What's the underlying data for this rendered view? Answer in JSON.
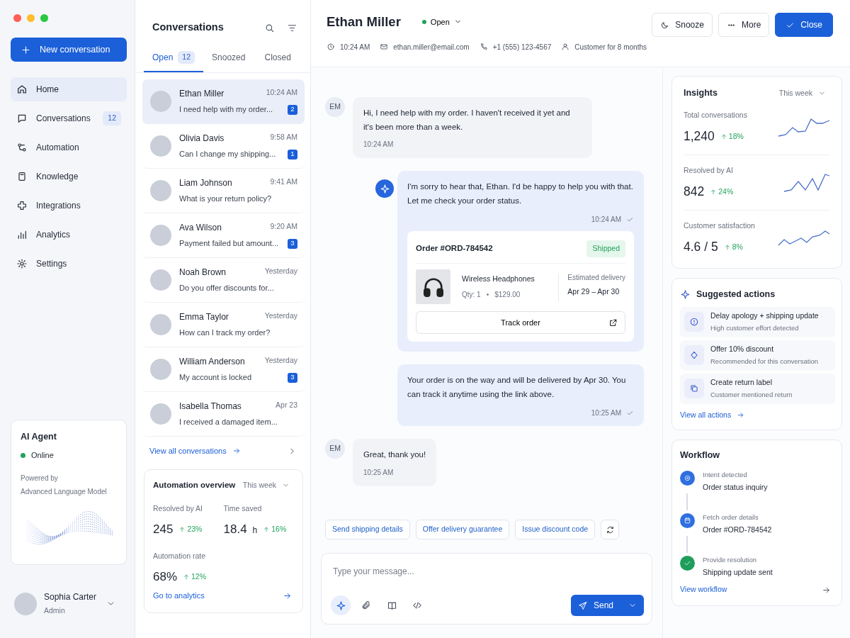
{
  "sidebar": {
    "new_button": "New conversation",
    "nav": [
      {
        "label": "Home",
        "selected": true
      },
      {
        "label": "Conversations",
        "selected": false,
        "count": "12"
      },
      {
        "label": "Automation",
        "selected": false
      },
      {
        "label": "Knowledge",
        "selected": false
      },
      {
        "label": "Integrations",
        "selected": false
      },
      {
        "label": "Analytics",
        "selected": false
      },
      {
        "label": "Settings",
        "selected": false
      }
    ],
    "ai_agent": {
      "title": "AI Agent",
      "status": "Online",
      "powered_by": "Powered by",
      "model": "Advanced Language Model"
    },
    "user": {
      "name": "Sophia Carter",
      "role": "Admin"
    }
  },
  "conversation_list": {
    "title": "Conversations",
    "tabs": [
      {
        "label": "Open",
        "count": "12",
        "selected": true
      },
      {
        "label": "Snoozed",
        "selected": false
      },
      {
        "label": "Closed",
        "selected": false
      }
    ],
    "items": [
      {
        "name": "Ethan Miller",
        "time": "10:24 AM",
        "preview": "I need help with my order...",
        "unread": "2",
        "selected": true
      },
      {
        "name": "Olivia Davis",
        "time": "9:58 AM",
        "preview": "Can I change my shipping...",
        "unread": "1",
        "selected": false
      },
      {
        "name": "Liam Johnson",
        "time": "9:41 AM",
        "preview": "What is your return policy?",
        "selected": false
      },
      {
        "name": "Ava Wilson",
        "time": "9:20 AM",
        "preview": "Payment failed but amount...",
        "unread": "3",
        "selected": false
      },
      {
        "name": "Noah Brown",
        "time": "Yesterday",
        "preview": "Do you offer discounts for...",
        "selected": false
      },
      {
        "name": "Emma Taylor",
        "time": "Yesterday",
        "preview": "How can I track my order?",
        "selected": false
      },
      {
        "name": "William Anderson",
        "time": "Yesterday",
        "preview": "My account is locked",
        "unread": "3",
        "selected": false
      },
      {
        "name": "Isabella Thomas",
        "time": "Apr 23",
        "preview": "I received a damaged item...",
        "selected": false
      }
    ],
    "view_all": "View all conversations"
  },
  "automation_overview": {
    "title": "Automation overview",
    "period": "This week",
    "stats": [
      {
        "label": "Resolved by AI",
        "value": "245",
        "change": "23%"
      },
      {
        "label": "Time saved",
        "value": "18.4",
        "unit": "h",
        "change": "16%"
      },
      {
        "label": "Automation rate",
        "value": "68%",
        "change": "12%"
      }
    ],
    "link": "Go to analytics"
  },
  "conversation": {
    "customer_name": "Ethan Miller",
    "status": "Open",
    "meta": [
      "10:24 AM",
      "ethan.miller@email.com",
      "+1 (555) 123-4567",
      "Customer for 8 months"
    ],
    "actions": [
      {
        "label": "Snooze",
        "kind": "secondary"
      },
      {
        "label": "More",
        "kind": "secondary"
      },
      {
        "label": "Close",
        "kind": "primary"
      }
    ]
  },
  "messages": [
    {
      "kind": "customer",
      "initials": "EM",
      "text": "Hi, I need help with my order. I haven't received it yet and it's been more than a week.",
      "time": "10:24 AM",
      "delivered": false
    },
    {
      "kind": "ai",
      "text": "I'm sorry to hear that, Ethan. I'd be happy to help you with that. Let me check your order status.",
      "time": "10:24 AM",
      "delivered": true,
      "order": {
        "number": "Order #ORD-784542",
        "status": "Shipped",
        "product": "Wireless Headphones",
        "qty": "Qty: 1",
        "separator": "•",
        "price": "$129.00",
        "delivery_label": "Estimated delivery",
        "delivery": "Apr 29 – Apr 30",
        "button": "Track order"
      }
    },
    {
      "kind": "ai",
      "text": "Your order is on the way and will be delivered by Apr 30. You can track it anytime using the link above.",
      "time": "10:25 AM",
      "delivered": true
    },
    {
      "kind": "customer",
      "initials": "EM",
      "text": "Great, thank you!",
      "time": "10:25 AM",
      "delivered": false
    }
  ],
  "quick_replies": [
    "Send shipping details",
    "Offer delivery guarantee",
    "Issue discount code"
  ],
  "composer": {
    "placeholder": "Type your message...",
    "send": "Send"
  },
  "insights": {
    "title": "Insights",
    "period": "This week",
    "metrics": [
      {
        "label": "Total conversations",
        "value": "1,240",
        "change": "18%"
      },
      {
        "label": "Resolved by AI",
        "value": "842",
        "change": "24%"
      },
      {
        "label": "Customer satisfaction",
        "value": "4.6 / 5",
        "change": "8%"
      }
    ]
  },
  "suggested_actions": {
    "title": "Suggested actions",
    "items": [
      {
        "title": "Delay apology + shipping update",
        "detail": "High customer effort detected"
      },
      {
        "title": "Offer 10% discount",
        "detail": "Recommended for this conversation"
      },
      {
        "title": "Create return label",
        "detail": "Customer mentioned return"
      }
    ],
    "link": "View all actions"
  },
  "workflow": {
    "title": "Workflow",
    "steps": [
      {
        "label": "Intent detected",
        "value": "Order status inquiry",
        "color": "#2f6fe0"
      },
      {
        "label": "Fetch order details",
        "value": "Order #ORD-784542",
        "color": "#2f6fe0"
      },
      {
        "label": "Provide resolution",
        "value": "Shipping update sent",
        "color": "#1e9e5a"
      }
    ],
    "link": "View workflow"
  }
}
